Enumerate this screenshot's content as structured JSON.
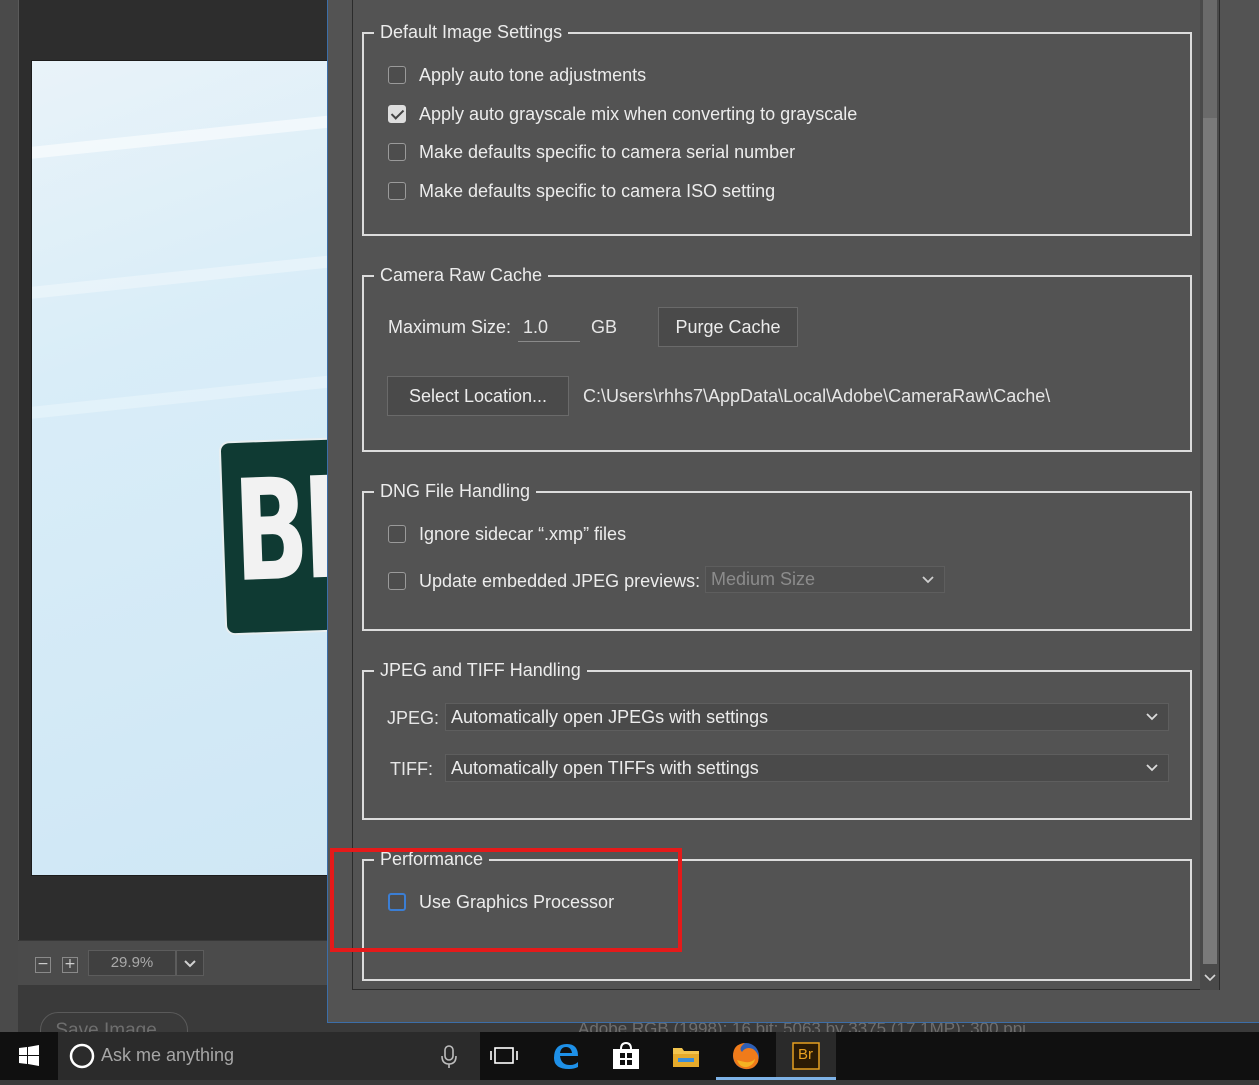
{
  "background": {
    "preview_sign_text": "BI",
    "zoom": {
      "value": "29.9%",
      "minus_icon": "zoom-out-icon",
      "plus_icon": "zoom-in-icon"
    },
    "save_image_label": "Save Image...",
    "status_info": "Adobe RGB (1998); 16 bit; 5063 by 3375 (17.1MP); 300 ppi"
  },
  "default_image_settings": {
    "title": "Default Image Settings",
    "options": [
      {
        "label": "Apply auto tone adjustments",
        "checked": false
      },
      {
        "label": "Apply auto grayscale mix when converting to grayscale",
        "checked": true
      },
      {
        "label": "Make defaults specific to camera serial number",
        "checked": false
      },
      {
        "label": "Make defaults specific to camera ISO setting",
        "checked": false
      }
    ]
  },
  "camera_raw_cache": {
    "title": "Camera Raw Cache",
    "max_size_label": "Maximum Size:",
    "max_size_value": "1.0",
    "unit": "GB",
    "purge_label": "Purge Cache",
    "select_location_label": "Select Location...",
    "path": "C:\\Users\\rhhs7\\AppData\\Local\\Adobe\\CameraRaw\\Cache\\"
  },
  "dng_file_handling": {
    "title": "DNG File Handling",
    "ignore_sidecar_label": "Ignore sidecar “.xmp” files",
    "ignore_sidecar_checked": false,
    "update_previews_label": "Update embedded JPEG previews:",
    "update_previews_checked": false,
    "preview_size_value": "Medium Size"
  },
  "jpeg_tiff_handling": {
    "title": "JPEG and TIFF Handling",
    "jpeg_label": "JPEG:",
    "jpeg_value": "Automatically open JPEGs with settings",
    "tiff_label": "TIFF:",
    "tiff_value": "Automatically open TIFFs with settings"
  },
  "performance": {
    "title": "Performance",
    "gpu_label": "Use Graphics Processor",
    "gpu_checked": false
  },
  "taskbar": {
    "search_placeholder": "Ask me anything",
    "bridge_label": "Br",
    "icons": [
      "windows-start-icon",
      "cortana-icon",
      "microphone-icon",
      "task-view-icon",
      "edge-icon",
      "store-icon",
      "file-explorer-icon",
      "firefox-icon",
      "adobe-bridge-icon"
    ]
  },
  "colors": {
    "dialog_bg": "#535353",
    "highlight": "#e51a1a",
    "focus_blue": "#3b7ed4",
    "taskbar_accent": "#7eb2e6"
  }
}
